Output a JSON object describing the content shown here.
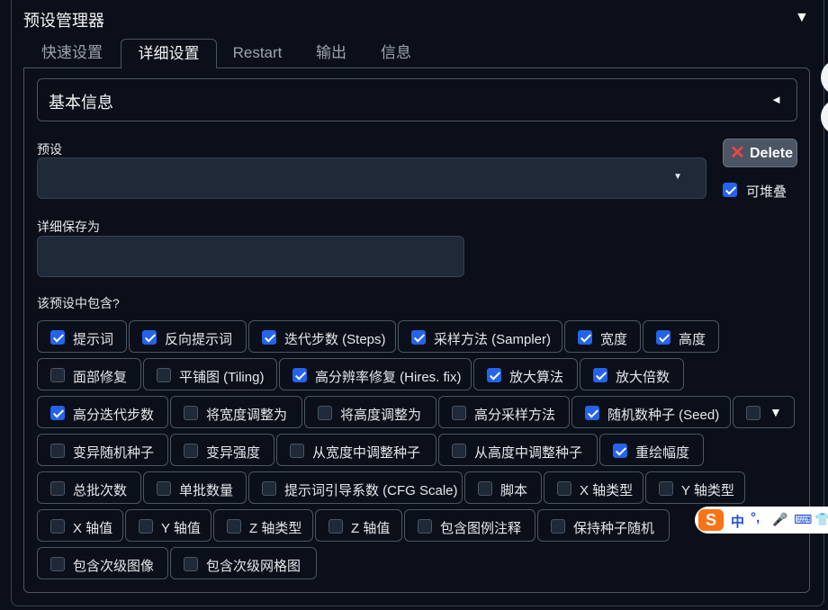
{
  "header": {
    "title": "预设管理器",
    "collapse_icon": "▼"
  },
  "tabs": [
    {
      "label": "快速设置",
      "active": false
    },
    {
      "label": "详细设置",
      "active": true
    },
    {
      "label": "Restart",
      "active": false
    },
    {
      "label": "输出",
      "active": false
    },
    {
      "label": "信息",
      "active": false
    }
  ],
  "accordion": {
    "label": "基本信息",
    "arrow": "◄"
  },
  "preset": {
    "label": "预设",
    "value": "",
    "caret": "▼"
  },
  "delete_button": {
    "icon": "✕",
    "label": "Delete"
  },
  "stackable": {
    "label": "可堆叠",
    "checked": true
  },
  "save_as": {
    "label": "详细保存为",
    "value": ""
  },
  "includes": {
    "label": "该预设中包含?",
    "items": [
      {
        "label": "提示词",
        "checked": true
      },
      {
        "label": "反向提示词",
        "checked": true
      },
      {
        "label": "迭代步数 (Steps)",
        "checked": true
      },
      {
        "label": "采样方法 (Sampler)",
        "checked": true
      },
      {
        "label": "宽度",
        "checked": true
      },
      {
        "label": "高度",
        "checked": true
      },
      {
        "label": "面部修复",
        "checked": false
      },
      {
        "label": "平铺图 (Tiling)",
        "checked": false
      },
      {
        "label": "高分辨率修复 (Hires. fix)",
        "checked": true
      },
      {
        "label": "放大算法",
        "checked": true
      },
      {
        "label": "放大倍数",
        "checked": true
      },
      {
        "label": "高分迭代步数",
        "checked": true
      },
      {
        "label": "将宽度调整为",
        "checked": false
      },
      {
        "label": "将高度调整为",
        "checked": false
      },
      {
        "label": "高分采样方法",
        "checked": false
      },
      {
        "label": "随机数种子 (Seed)",
        "checked": true
      },
      {
        "label": "▼",
        "checked": false
      },
      {
        "label": "变异随机种子",
        "checked": false
      },
      {
        "label": "变异强度",
        "checked": false
      },
      {
        "label": "从宽度中调整种子",
        "checked": false
      },
      {
        "label": "从高度中调整种子",
        "checked": false
      },
      {
        "label": "重绘幅度",
        "checked": true
      },
      {
        "label": "总批次数",
        "checked": false
      },
      {
        "label": "单批数量",
        "checked": false
      },
      {
        "label": "提示词引导系数 (CFG Scale)",
        "checked": false
      },
      {
        "label": "脚本",
        "checked": false
      },
      {
        "label": "X 轴类型",
        "checked": false
      },
      {
        "label": "Y 轴类型",
        "checked": false
      },
      {
        "label": "X 轴值",
        "checked": false
      },
      {
        "label": "Y 轴值",
        "checked": false
      },
      {
        "label": "Z 轴类型",
        "checked": false
      },
      {
        "label": "Z 轴值",
        "checked": false
      },
      {
        "label": "包含图例注释",
        "checked": false
      },
      {
        "label": "保持种子随机",
        "checked": false
      },
      {
        "label": "包含次级图像",
        "checked": false
      },
      {
        "label": "包含次级网格图",
        "checked": false
      }
    ]
  },
  "ime_toolbar": {
    "logo": "S",
    "mode": "中",
    "punct": "°,",
    "mic_icon": "🎤",
    "keyboard_icon": "⌨",
    "skin_icon": "👕"
  },
  "colors": {
    "accent": "#2563eb",
    "background": "#0b0f19",
    "input_bg": "#1f2937",
    "border": "#4b5563",
    "delete_x": "#ef4444"
  }
}
